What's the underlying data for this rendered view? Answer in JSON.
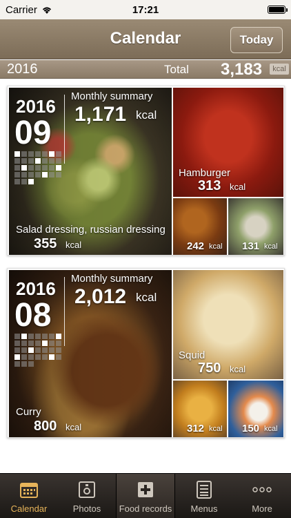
{
  "status": {
    "carrier": "Carrier",
    "time": "17:21"
  },
  "nav": {
    "title": "Calendar",
    "today_label": "Today"
  },
  "total": {
    "year": "2016",
    "label": "Total",
    "value": "3,183",
    "unit": "kcal"
  },
  "months": [
    {
      "year": "2016",
      "month": "09",
      "summary_label": "Monthly summary",
      "summary_value": "1,171",
      "summary_unit": "kcal",
      "feature": {
        "name": "Salad dressing, russian dressing",
        "value": "355",
        "unit": "kcal"
      },
      "side": {
        "name": "Hamburger",
        "value": "313",
        "unit": "kcal"
      },
      "mini": [
        {
          "value": "242",
          "unit": "kcal"
        },
        {
          "value": "131",
          "unit": "kcal"
        }
      ]
    },
    {
      "year": "2016",
      "month": "08",
      "summary_label": "Monthly summary",
      "summary_value": "2,012",
      "summary_unit": "kcal",
      "feature": {
        "name": "Curry",
        "value": "800",
        "unit": "kcal"
      },
      "side": {
        "name": "Squid",
        "value": "750",
        "unit": "kcal"
      },
      "mini": [
        {
          "value": "312",
          "unit": "kcal"
        },
        {
          "value": "150",
          "unit": "kcal"
        }
      ]
    }
  ],
  "tabs": [
    {
      "label": "Calendar",
      "icon": "calendar-icon",
      "active": true
    },
    {
      "label": "Photos",
      "icon": "photos-icon"
    },
    {
      "label": "Food records",
      "icon": "plus-icon"
    },
    {
      "label": "Menus",
      "icon": "menus-icon"
    },
    {
      "label": "More",
      "icon": "more-icon"
    }
  ],
  "colors": {
    "accent": "#e7b45a",
    "nav": "#8a7a66"
  }
}
